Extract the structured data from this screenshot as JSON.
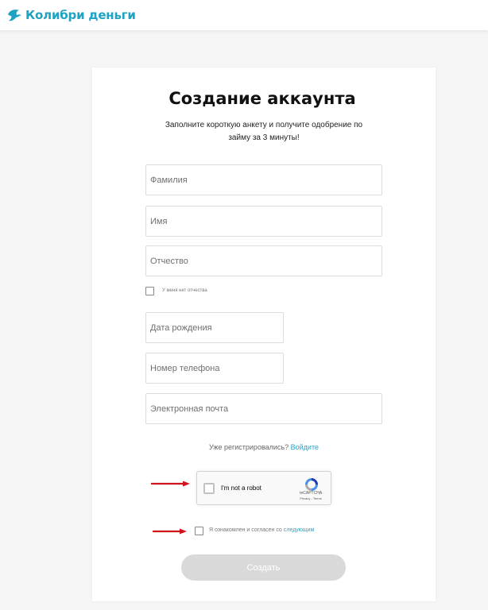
{
  "header": {
    "brand_name": "Колибри деньги",
    "logo_icon": "hummingbird-icon",
    "brand_color": "#1fa3c4"
  },
  "form": {
    "title": "Создание аккаунта",
    "subtitle": "Заполните короткую анкету и получите одобрение по займу за 3 минуты!",
    "fields": {
      "last_name_placeholder": "Фамилия",
      "first_name_placeholder": "Имя",
      "patronymic_placeholder": "Отчество",
      "birth_date_placeholder": "Дата рождения",
      "phone_placeholder": "Номер телефона",
      "email_placeholder": "Электронная почта"
    },
    "no_patronymic_label": "У меня нет отчества",
    "already_registered_text": "Уже регистрировались?",
    "login_link_label": "Войдите",
    "link_color": "#2aa3c9",
    "recaptcha": {
      "checkbox_label": "I'm not a robot",
      "brand": "reCAPTCHA",
      "terms": "Privacy - Terms",
      "logo_icon": "recaptcha-icon"
    },
    "agreement_text": "Я ознакомлен и согласен со",
    "agreement_link_label": "следующим",
    "submit_label": "Создать",
    "submit_disabled_color": "#d9d9d9"
  },
  "annotations": {
    "arrow_color": "#d0121b",
    "arrow_icon": "red-arrow-icon"
  }
}
